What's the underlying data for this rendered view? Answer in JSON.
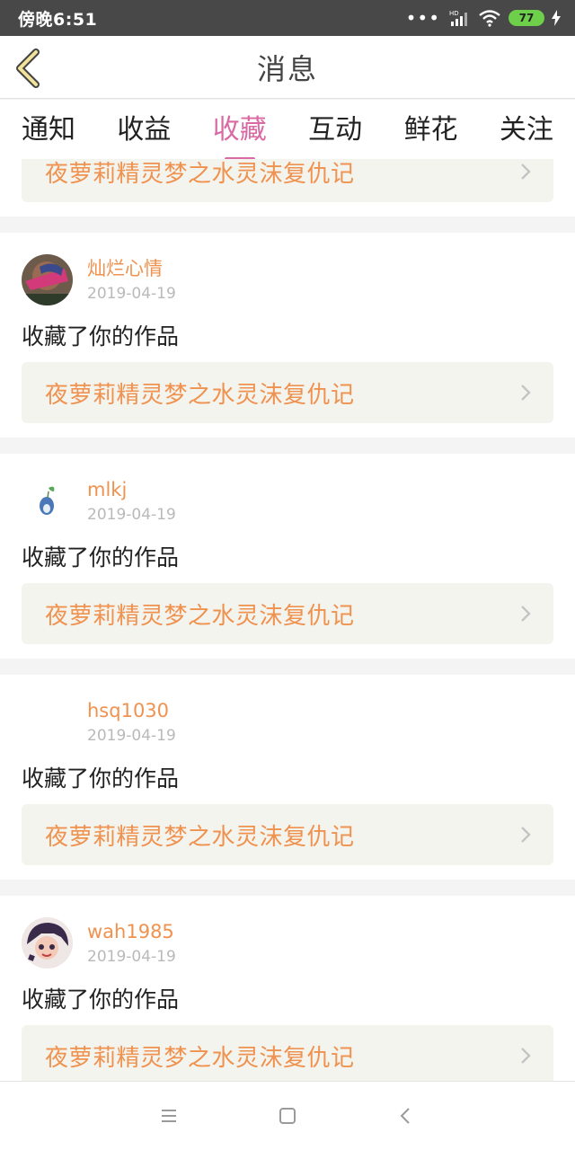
{
  "status_bar": {
    "time": "傍晚6:51",
    "battery": "77",
    "network": "HD"
  },
  "header": {
    "title": "消息"
  },
  "tabs": [
    {
      "label": "通知"
    },
    {
      "label": "收益"
    },
    {
      "label": "收藏",
      "active": true
    },
    {
      "label": "互动"
    },
    {
      "label": "鲜花"
    },
    {
      "label": "关注"
    }
  ],
  "partial_card": {
    "work_title": "夜萝莉精灵梦之水灵沫复仇记"
  },
  "messages": [
    {
      "user": "灿烂心情",
      "date": "2019-04-19",
      "action": "收藏了你的作品",
      "work_title": "夜萝莉精灵梦之水灵沫复仇记"
    },
    {
      "user": "mlkj",
      "date": "2019-04-19",
      "action": "收藏了你的作品",
      "work_title": "夜萝莉精灵梦之水灵沫复仇记"
    },
    {
      "user": "hsq1030",
      "date": "2019-04-19",
      "action": "收藏了你的作品",
      "work_title": "夜萝莉精灵梦之水灵沫复仇记"
    },
    {
      "user": "wah1985",
      "date": "2019-04-19",
      "action": "收藏了你的作品",
      "work_title": "夜萝莉精灵梦之水灵沫复仇记"
    }
  ],
  "colors": {
    "accent": "#d96aa3",
    "link": "#f0924f",
    "status_bar": "#484848"
  },
  "icons": [
    "back-icon",
    "wifi-icon",
    "signal-icon",
    "battery-icon",
    "chevron-right-icon",
    "menu-icon",
    "home-icon",
    "nav-back-icon"
  ]
}
